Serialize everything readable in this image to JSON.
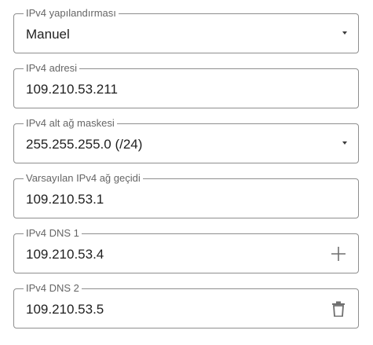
{
  "fields": [
    {
      "label": "IPv4 yapılandırması",
      "value": "Manuel",
      "control": "dropdown",
      "icon": "chevron-down-icon"
    },
    {
      "label": "IPv4 adresi",
      "value": "109.210.53.211",
      "control": "text"
    },
    {
      "label": "IPv4 alt ağ maskesi",
      "value": "255.255.255.0 (/24)",
      "control": "dropdown",
      "icon": "chevron-down-icon"
    },
    {
      "label": "Varsayılan IPv4 ağ geçidi",
      "value": "109.210.53.1",
      "control": "text"
    },
    {
      "label": "IPv4 DNS 1",
      "value": "109.210.53.4",
      "control": "text",
      "icon": "plus-icon"
    },
    {
      "label": "IPv4 DNS 2",
      "value": "109.210.53.5",
      "control": "text",
      "icon": "trash-icon"
    }
  ],
  "colors": {
    "border": "#8e8e8e",
    "label": "#666666",
    "text": "#1f1f1f",
    "icon": "#6f6f6f"
  }
}
